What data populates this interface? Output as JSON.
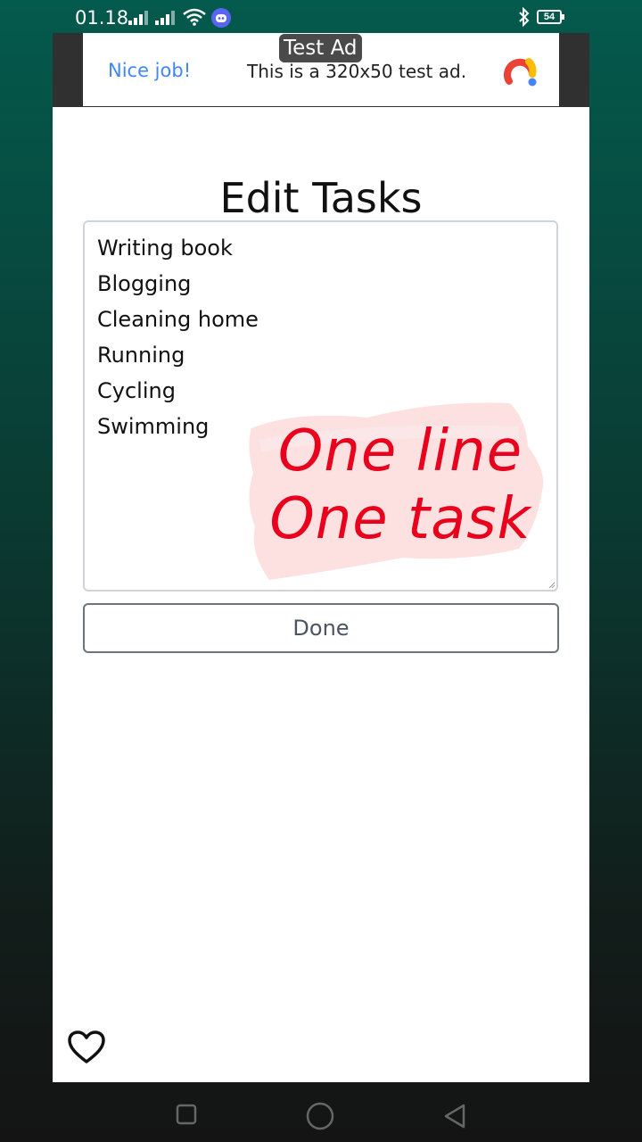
{
  "status_bar": {
    "time": "01.18",
    "battery": "54",
    "icons": [
      "signal-icon",
      "signal-icon",
      "wifi-icon",
      "discord-icon",
      "bluetooth-icon",
      "battery-icon"
    ]
  },
  "ad": {
    "badge": "Test Ad",
    "nice_text": "Nice job!",
    "body_text": "This is a 320x50 test ad.",
    "logo_icon": "ad-logo-icon"
  },
  "page": {
    "title": "Edit Tasks",
    "tasks": [
      "Writing book",
      "Blogging",
      "Cleaning home",
      "Running",
      "Cycling",
      "Swimming"
    ],
    "note_line1": "One line",
    "note_line2": "One task",
    "done_label": "Done",
    "favorite_icon": "heart-icon"
  },
  "navigation_bar": {
    "buttons": [
      "recent-apps-icon",
      "home-icon",
      "back-icon"
    ]
  },
  "colors": {
    "note_red": "#e8001d",
    "ad_blue": "#4285f4",
    "background_teal": "#045a4d"
  }
}
